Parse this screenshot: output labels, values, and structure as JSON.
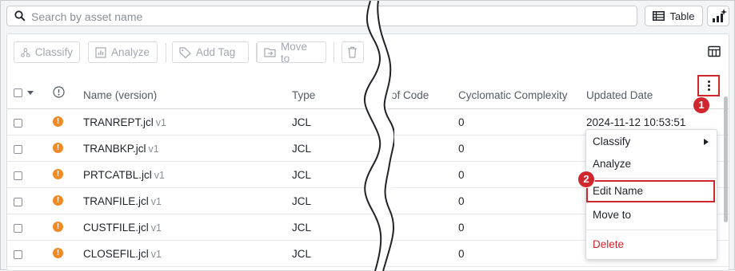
{
  "search": {
    "placeholder": "Search by asset name",
    "icon": "search-icon"
  },
  "view_toggle": {
    "label": "Table",
    "icon": "table-icon"
  },
  "chart_button": {
    "icon": "chart-sparkle-icon"
  },
  "toolbar": {
    "classify": "Classify",
    "analyze": "Analyze",
    "add_tag": "Add Tag",
    "move_to": "Move to",
    "delete_icon": "trash-icon",
    "columns_icon": "columns-grid-icon"
  },
  "table": {
    "headers": {
      "name": "Name (version)",
      "type": "Type",
      "lines_of_code": "of Code",
      "cyclomatic": "Cyclomatic Complexity",
      "updated": "Updated Date"
    },
    "rows": [
      {
        "name": "TRANREPT.jcl",
        "version": "v1",
        "type": "JCL",
        "complexity": "0",
        "updated": "2024-11-12 10:53:51"
      },
      {
        "name": "TRANBKP.jcl",
        "version": "v1",
        "type": "JCL",
        "complexity": "0",
        "updated": ""
      },
      {
        "name": "PRTCATBL.jcl",
        "version": "v1",
        "type": "JCL",
        "complexity": "0",
        "updated": ""
      },
      {
        "name": "TRANFILE.jcl",
        "version": "v1",
        "type": "JCL",
        "complexity": "0",
        "updated": ""
      },
      {
        "name": "CUSTFILE.jcl",
        "version": "v1",
        "type": "JCL",
        "complexity": "0",
        "updated": ""
      },
      {
        "name": "CLOSEFIL.jcl",
        "version": "v1",
        "type": "JCL",
        "complexity": "0",
        "updated": ""
      }
    ]
  },
  "context_menu": {
    "items": [
      {
        "label": "Classify",
        "has_submenu": true
      },
      {
        "label": "Analyze"
      },
      {
        "label": "Edit Name"
      },
      {
        "label": "Move to"
      },
      {
        "label": "Delete"
      }
    ]
  },
  "callouts": {
    "one": "1",
    "two": "2"
  },
  "colors": {
    "callout": "#d0262e",
    "warning": "#f08a24",
    "delete": "#d0262e"
  }
}
